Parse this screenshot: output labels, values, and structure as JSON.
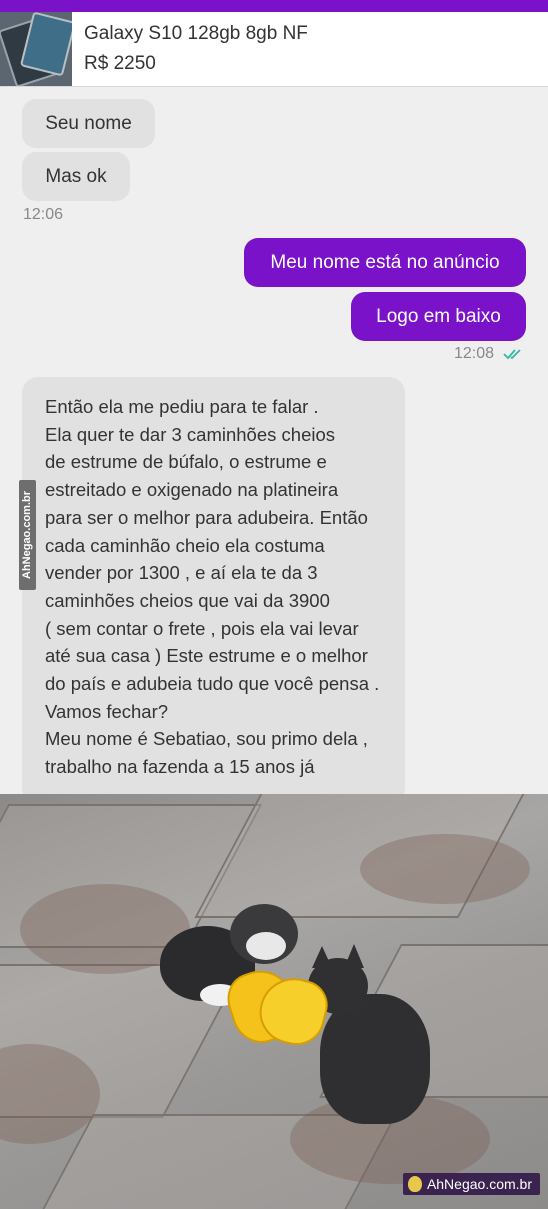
{
  "listing": {
    "title": "Galaxy S10 128gb 8gb NF",
    "price": "R$ 2250"
  },
  "messages": [
    {
      "text": "Seu nome",
      "dir": "in"
    },
    {
      "text": "Mas ok",
      "dir": "in"
    },
    {
      "time": "12:06"
    },
    {
      "text": "Meu nome está no anúncio",
      "dir": "out"
    },
    {
      "text": "Logo em baixo",
      "dir": "out"
    },
    {
      "time": "12:08"
    }
  ],
  "long_message": [
    "Então ela me pediu para te falar .",
    "Ela quer te dar 3 caminhões cheios",
    "de estrume de búfalo,  o estrume e",
    "estreitado e oxigenado na platineira",
    "para ser o melhor para adubeira. Então",
    "cada caminhão cheio ela costuma",
    "vender por 1300 , e aí ela te da 3",
    "caminhões cheios que vai da 3900",
    "( sem contar o frete , pois ela vai levar",
    "até sua casa ) Este estrume e o melhor",
    "do país e adubeia tudo que você pensa .",
    "Vamos fechar?",
    "Meu nome é Sebatiao, sou primo dela ,",
    "trabalho na fazenda a 15 anos já"
  ],
  "watermarks": {
    "side": "AhNegao.com.br",
    "corner": "AhNegao.com.br"
  },
  "colors": {
    "accent": "#7a12c9",
    "incoming": "#e1e1e1",
    "read_check": "#34b7a6"
  }
}
